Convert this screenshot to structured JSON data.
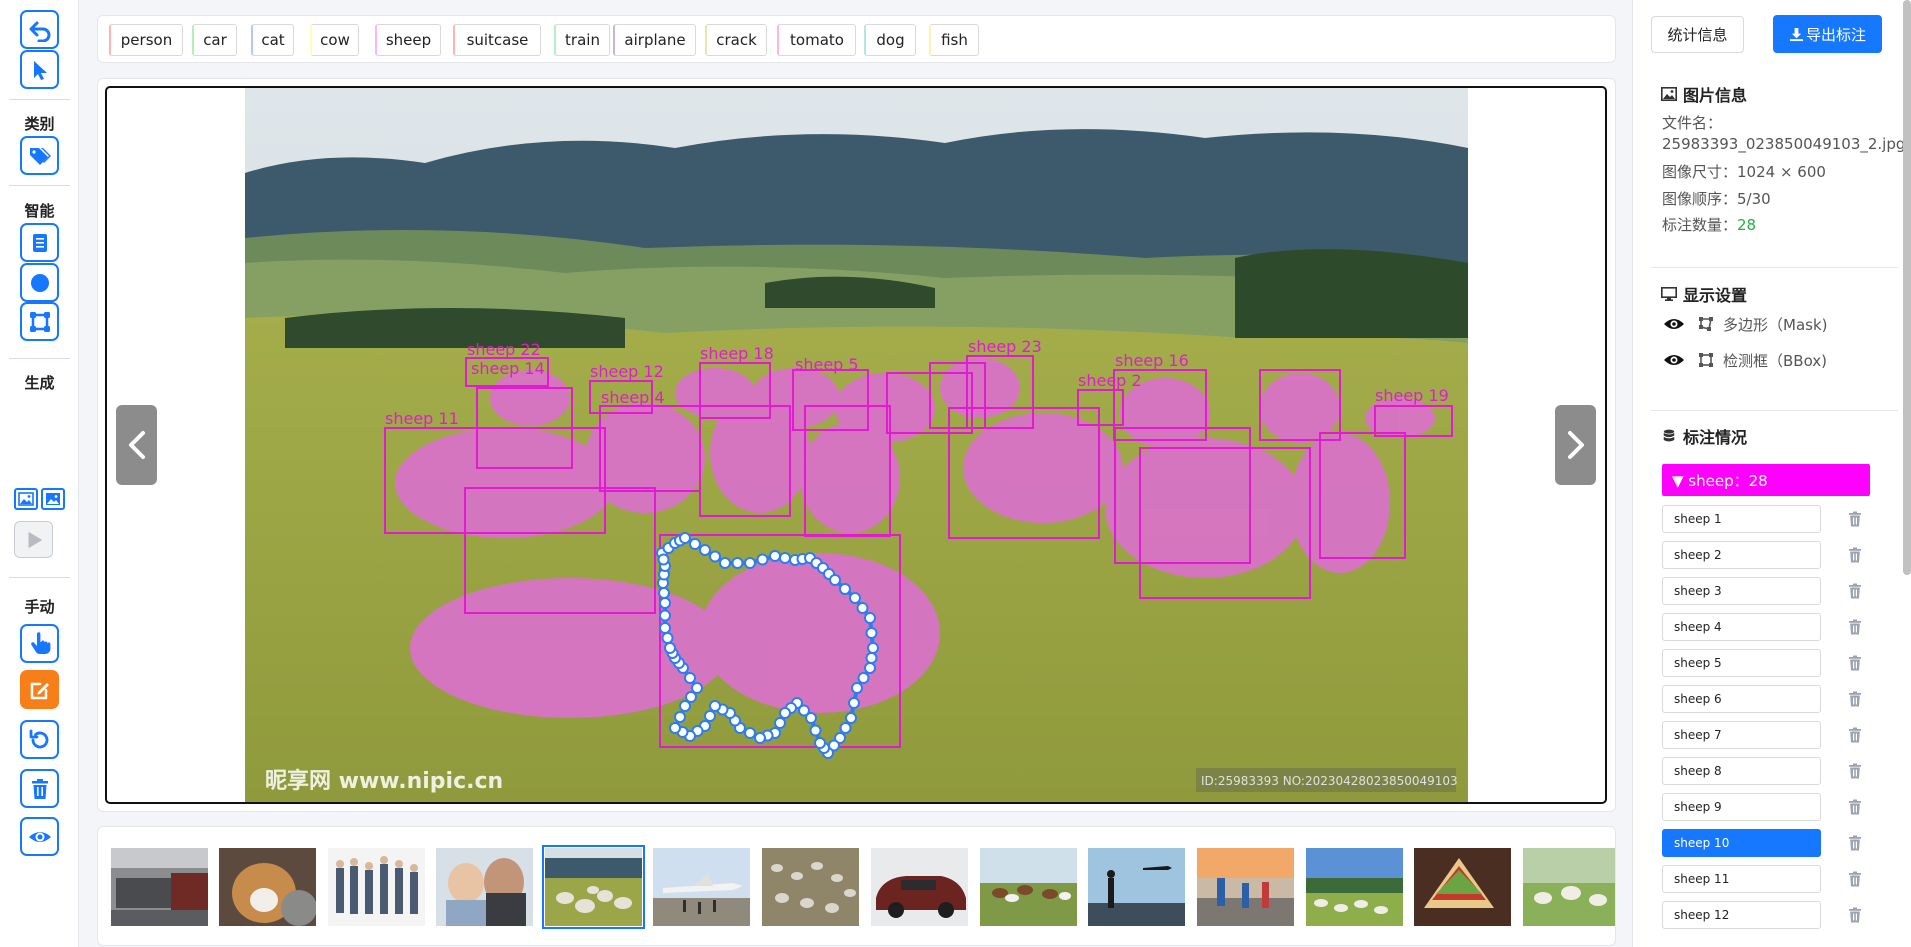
{
  "toolbar": {
    "sections": {
      "category": "类别",
      "smart": "智能",
      "generate": "生成",
      "manual": "手动"
    }
  },
  "categories": [
    "person",
    "car",
    "cat",
    "cow",
    "sheep",
    "suitcase",
    "train",
    "airplane",
    "crack",
    "tomato",
    "dog",
    "fish"
  ],
  "category_colors": [
    "#ffb3b3",
    "#b3f0b3",
    "#b3c6ff",
    "#ffffb3",
    "#ffb3ff",
    "#ffb3b3",
    "#b3f0c8",
    "#c8b3e6",
    "#e6e6b3",
    "#ffb3e6",
    "#b3e6e0",
    "#fff0b3"
  ],
  "canvas": {
    "box_labels": [
      "sheep 22",
      "sheep 14",
      "sheep 12",
      "sheep 4",
      "sheep 18",
      "sheep 5",
      "sheep 23",
      "sheep 16",
      "sheep 2",
      "sheep 19",
      "sheep 11"
    ],
    "watermark_left": "昵享网 www.nipic.cn",
    "watermark_right": "ID:25983393 NO:20230428023850049103",
    "mask_color": "#ff00ff",
    "handle_color": "#2b7cf5"
  },
  "right_panel": {
    "stats_button": "统计信息",
    "export_button": "导出标注",
    "image_info": {
      "title": "图片信息",
      "filename_label": "文件名：",
      "filename": "25983393_023850049103_2.jpg",
      "size_line": "图像尺寸：1024 × 600",
      "order_line": "图像顺序：5/30",
      "count_label": "标注数量：",
      "count": "28"
    },
    "display_settings": {
      "title": "显示设置",
      "polygon": "多边形（Mask)",
      "bbox": "检测框（BBox)"
    },
    "annotations": {
      "title": "标注情况",
      "group": "▼  sheep：28",
      "items": [
        "sheep 1",
        "sheep 2",
        "sheep 3",
        "sheep 4",
        "sheep 5",
        "sheep 6",
        "sheep 7",
        "sheep 8",
        "sheep 9",
        "sheep 10",
        "sheep 11",
        "sheep 12"
      ],
      "selected": "sheep 10"
    }
  },
  "thumbnails": [
    "station-train",
    "dog-cat",
    "people-group",
    "man-baby",
    "sheep-field",
    "airport-plane",
    "sheep-flock",
    "red-car",
    "cows-pasture",
    "airport-silhouette",
    "runners-street",
    "sheep-hill",
    "sandwich",
    "sheep-grass"
  ]
}
